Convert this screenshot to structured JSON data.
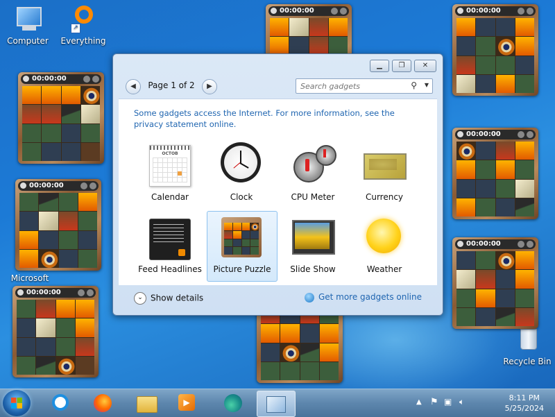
{
  "desktop": {
    "icons": [
      {
        "label": "Computer"
      },
      {
        "label": "Everything"
      },
      {
        "label": "Microsoft"
      },
      {
        "label": "Recycle Bin"
      }
    ]
  },
  "puzzle_gadget": {
    "timer": "00:00:00"
  },
  "gadgets_window": {
    "pager": {
      "label": "Page 1 of 2",
      "prev": "◀",
      "next": "▶"
    },
    "search": {
      "placeholder": "Search gadgets"
    },
    "info_text": "Some gadgets access the Internet.  For more information, see the privacy statement online.",
    "gadgets": [
      {
        "label": "Calendar",
        "icon": "calendar-icon"
      },
      {
        "label": "Clock",
        "icon": "clock-icon"
      },
      {
        "label": "CPU Meter",
        "icon": "cpu-meter-icon"
      },
      {
        "label": "Currency",
        "icon": "currency-icon"
      },
      {
        "label": "Feed Headlines",
        "icon": "feed-headlines-icon"
      },
      {
        "label": "Picture Puzzle",
        "icon": "picture-puzzle-icon",
        "selected": true
      },
      {
        "label": "Slide Show",
        "icon": "slide-show-icon"
      },
      {
        "label": "Weather",
        "icon": "weather-icon"
      }
    ],
    "show_details": "Show details",
    "get_more": "Get more gadgets online",
    "calendar_month": "OCTOB"
  },
  "taskbar": {
    "clock_time": "8:11 PM",
    "clock_date": "5/25/2024"
  },
  "colors": {
    "accent": "#1f65b0",
    "desktop": "#1c7ad6",
    "taskbar": "#5d86ad"
  }
}
